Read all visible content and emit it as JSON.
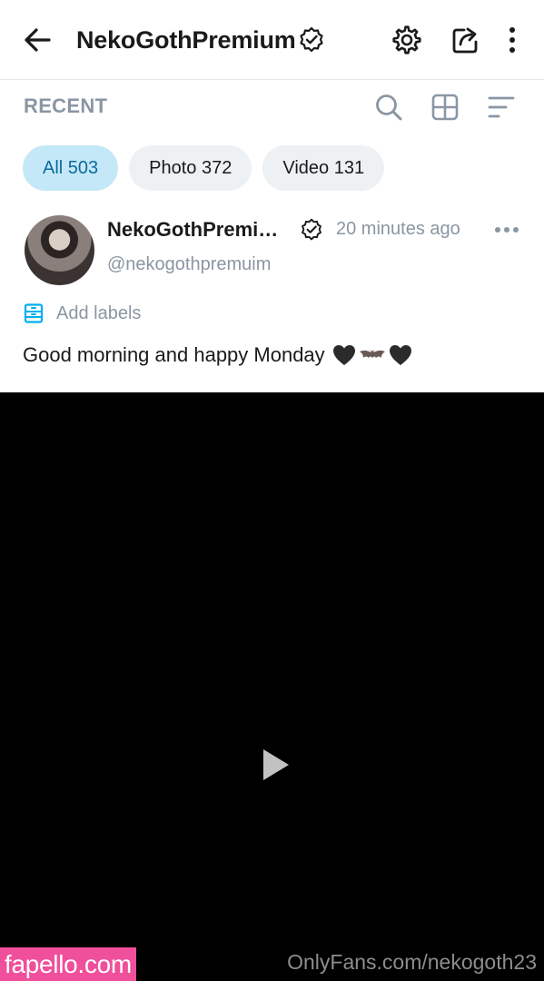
{
  "header": {
    "title": "NekoGothPremium",
    "icons": [
      "back-arrow-icon",
      "verified-icon",
      "gear-icon",
      "share-icon",
      "more-vertical-icon"
    ]
  },
  "section": {
    "title": "RECENT",
    "icons": [
      "search-icon",
      "grid-icon",
      "sort-icon"
    ]
  },
  "filters": [
    {
      "label": "All 503",
      "active": true
    },
    {
      "label": "Photo 372",
      "active": false
    },
    {
      "label": "Video 131",
      "active": false
    }
  ],
  "post": {
    "name": "NekoGothPremi…",
    "time": "20 minutes ago",
    "handle": "@nekogothpremuim",
    "labels_action": "Add labels",
    "caption": "Good morning and happy Monday",
    "caption_emoji": "black-heart bat black-heart"
  },
  "video": {
    "icon": "play-icon"
  },
  "watermarks": {
    "left": "fapello.com",
    "right": "OnlyFans.com/nekogoth23"
  },
  "colors": {
    "accent": "#00aff0",
    "active_chip_bg": "#c5e8f8",
    "active_chip_text": "#0b6b9a",
    "muted_text": "#8a96a3",
    "watermark_pink": "#ef4f9b"
  }
}
